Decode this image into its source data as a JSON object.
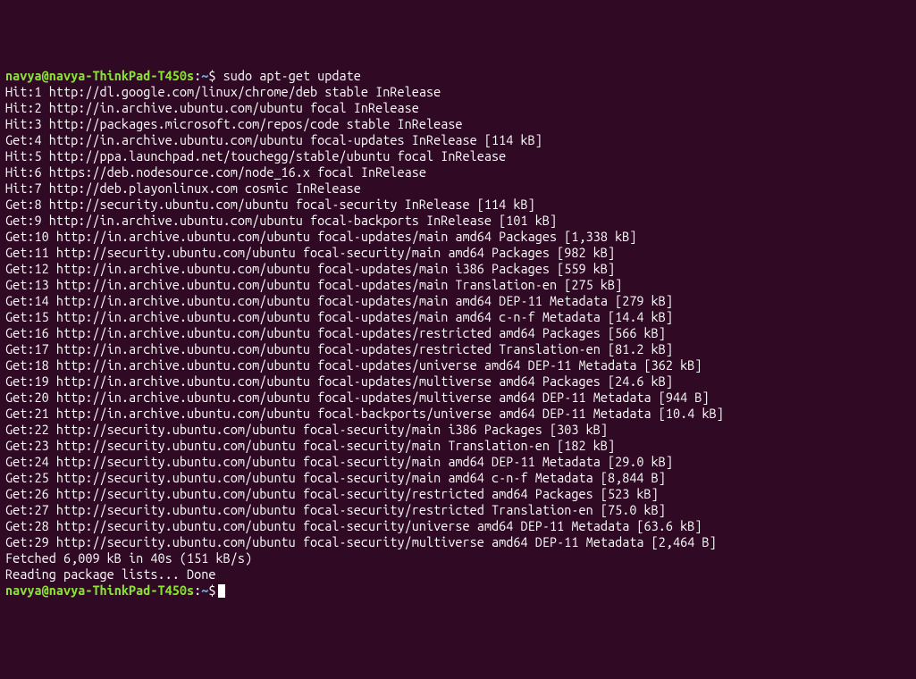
{
  "prompt1": {
    "user_host": "navya@navya-ThinkPad-T450s",
    "colon": ":",
    "path": "~",
    "dollar": "$",
    "command": " sudo apt-get update"
  },
  "lines": [
    "Hit:1 http://dl.google.com/linux/chrome/deb stable InRelease",
    "Hit:2 http://in.archive.ubuntu.com/ubuntu focal InRelease",
    "Hit:3 http://packages.microsoft.com/repos/code stable InRelease",
    "Get:4 http://in.archive.ubuntu.com/ubuntu focal-updates InRelease [114 kB]",
    "Hit:5 http://ppa.launchpad.net/touchegg/stable/ubuntu focal InRelease",
    "Hit:6 https://deb.nodesource.com/node_16.x focal InRelease",
    "Hit:7 http://deb.playonlinux.com cosmic InRelease",
    "Get:8 http://security.ubuntu.com/ubuntu focal-security InRelease [114 kB]",
    "Get:9 http://in.archive.ubuntu.com/ubuntu focal-backports InRelease [101 kB]",
    "Get:10 http://in.archive.ubuntu.com/ubuntu focal-updates/main amd64 Packages [1,338 kB]",
    "Get:11 http://security.ubuntu.com/ubuntu focal-security/main amd64 Packages [982 kB]",
    "Get:12 http://in.archive.ubuntu.com/ubuntu focal-updates/main i386 Packages [559 kB]",
    "Get:13 http://in.archive.ubuntu.com/ubuntu focal-updates/main Translation-en [275 kB]",
    "Get:14 http://in.archive.ubuntu.com/ubuntu focal-updates/main amd64 DEP-11 Metadata [279 kB]",
    "Get:15 http://in.archive.ubuntu.com/ubuntu focal-updates/main amd64 c-n-f Metadata [14.4 kB]",
    "Get:16 http://in.archive.ubuntu.com/ubuntu focal-updates/restricted amd64 Packages [566 kB]",
    "Get:17 http://in.archive.ubuntu.com/ubuntu focal-updates/restricted Translation-en [81.2 kB]",
    "Get:18 http://in.archive.ubuntu.com/ubuntu focal-updates/universe amd64 DEP-11 Metadata [362 kB]",
    "Get:19 http://in.archive.ubuntu.com/ubuntu focal-updates/multiverse amd64 Packages [24.6 kB]",
    "Get:20 http://in.archive.ubuntu.com/ubuntu focal-updates/multiverse amd64 DEP-11 Metadata [944 B]",
    "Get:21 http://in.archive.ubuntu.com/ubuntu focal-backports/universe amd64 DEP-11 Metadata [10.4 kB]",
    "Get:22 http://security.ubuntu.com/ubuntu focal-security/main i386 Packages [303 kB]",
    "Get:23 http://security.ubuntu.com/ubuntu focal-security/main Translation-en [182 kB]",
    "Get:24 http://security.ubuntu.com/ubuntu focal-security/main amd64 DEP-11 Metadata [29.0 kB]",
    "Get:25 http://security.ubuntu.com/ubuntu focal-security/main amd64 c-n-f Metadata [8,844 B]",
    "Get:26 http://security.ubuntu.com/ubuntu focal-security/restricted amd64 Packages [523 kB]",
    "Get:27 http://security.ubuntu.com/ubuntu focal-security/restricted Translation-en [75.0 kB]",
    "Get:28 http://security.ubuntu.com/ubuntu focal-security/universe amd64 DEP-11 Metadata [63.6 kB]",
    "Get:29 http://security.ubuntu.com/ubuntu focal-security/multiverse amd64 DEP-11 Metadata [2,464 B]",
    "Fetched 6,009 kB in 40s (151 kB/s)",
    "Reading package lists... Done"
  ],
  "prompt2": {
    "user_host": "navya@navya-ThinkPad-T450s",
    "colon": ":",
    "path": "~",
    "dollar": "$"
  }
}
